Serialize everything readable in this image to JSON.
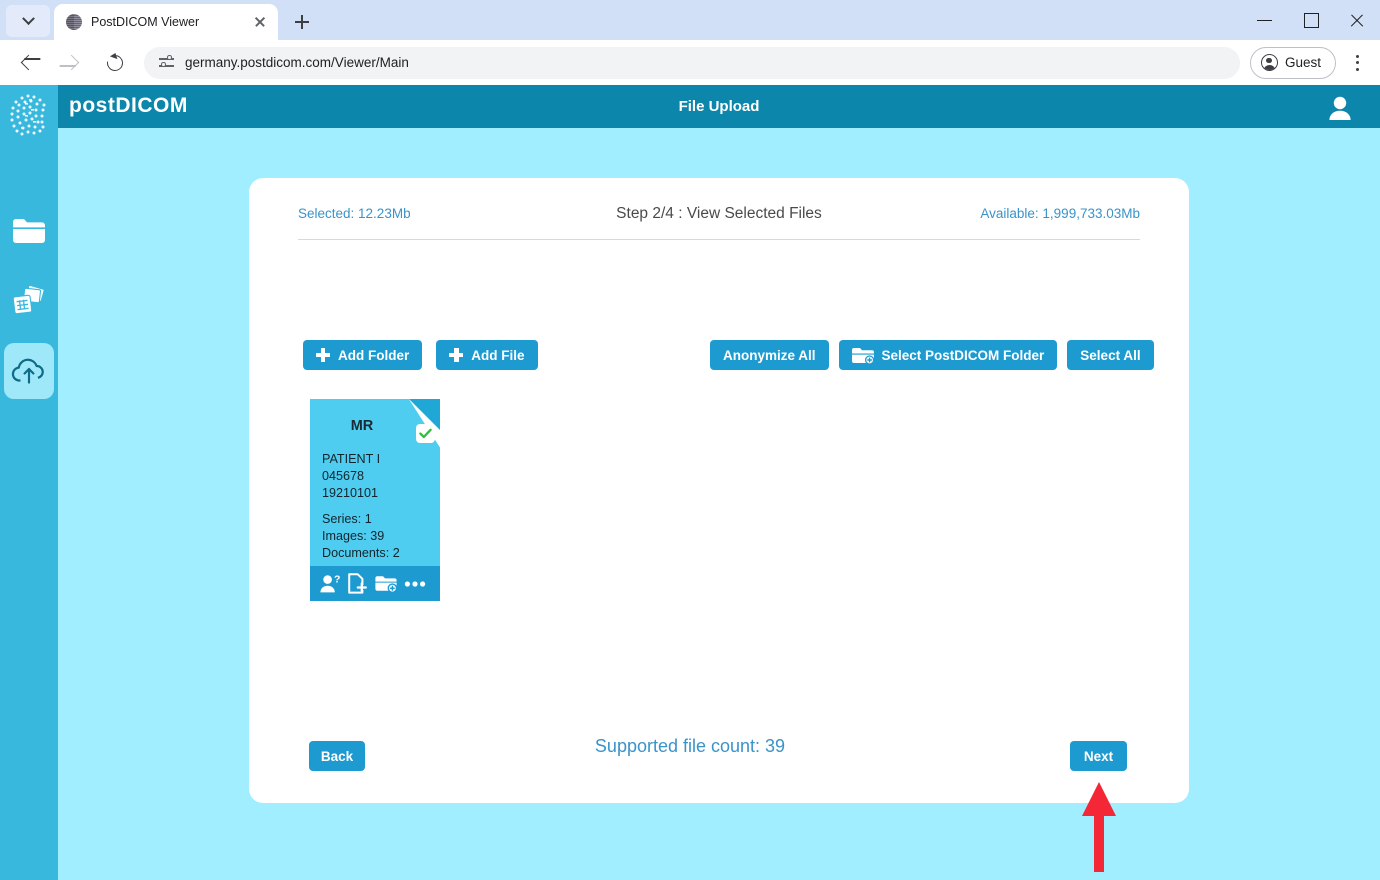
{
  "browser": {
    "tab_title": "PostDICOM Viewer",
    "url": "germany.postdicom.com/Viewer/Main",
    "profile_label": "Guest",
    "icons": {
      "tab_list": "chevron-down-icon",
      "favicon": "postdicom-favicon",
      "close_tab": "close-icon",
      "new_tab": "new-tab-icon",
      "back": "back-arrow-icon",
      "forward": "forward-arrow-icon",
      "reload": "reload-icon",
      "site_info": "site-settings-icon",
      "profile": "account-circle-icon",
      "menu": "kebab-menu-icon",
      "minimize": "minimize-icon",
      "maximize": "maximize-icon",
      "close_window": "window-close-icon"
    }
  },
  "app": {
    "brand": "postDICOM",
    "page_title": "File Upload",
    "header_color": "#0d86ab",
    "sidebar_color": "#38b8dd",
    "background_color": "#a0eeff",
    "accent_color": "#1d9bd1",
    "link_color": "#3a93c9",
    "tile_color": "#4ecdf0",
    "profile_icon": "user-avatar-icon"
  },
  "sidebar": {
    "items": [
      {
        "name": "logo",
        "icon": "brain-logo-icon",
        "active": false
      },
      {
        "name": "folders",
        "icon": "folder-icon",
        "active": false
      },
      {
        "name": "studies",
        "icon": "image-stack-icon",
        "active": false
      },
      {
        "name": "upload",
        "icon": "cloud-upload-icon",
        "active": true
      }
    ]
  },
  "card": {
    "selected_label": "Selected: 12.23Mb",
    "step_title": "Step 2/4 : View Selected Files",
    "available_label": "Available: 1,999,733.03Mb"
  },
  "toolbar": {
    "left": [
      {
        "label": "Add Folder",
        "icon": "plus-icon"
      },
      {
        "label": "Add File",
        "icon": "plus-icon"
      }
    ],
    "right": [
      {
        "label": "Anonymize All",
        "icon": ""
      },
      {
        "label": "Select PostDICOM Folder",
        "icon": "folder-add-icon"
      },
      {
        "label": "Select All",
        "icon": ""
      }
    ]
  },
  "files": [
    {
      "modality": "MR",
      "patient_name": "PATIENT I",
      "patient_id": "045678",
      "study_date": "19210101",
      "series": "Series: 1",
      "images": "Images: 39",
      "documents": "Documents: 2",
      "selected": true,
      "actions": [
        {
          "name": "anonymize-patient",
          "icon": "person-question-icon"
        },
        {
          "name": "add-document",
          "icon": "file-add-icon"
        },
        {
          "name": "add-to-folder",
          "icon": "folder-add-icon"
        },
        {
          "name": "more-options",
          "icon": "ellipsis-icon"
        }
      ]
    }
  ],
  "footer": {
    "supported_count": "Supported file count: 39",
    "back_label": "Back",
    "next_label": "Next"
  },
  "annotation": {
    "type": "arrow-up",
    "color": "#f32735",
    "points_to": "next-button"
  }
}
